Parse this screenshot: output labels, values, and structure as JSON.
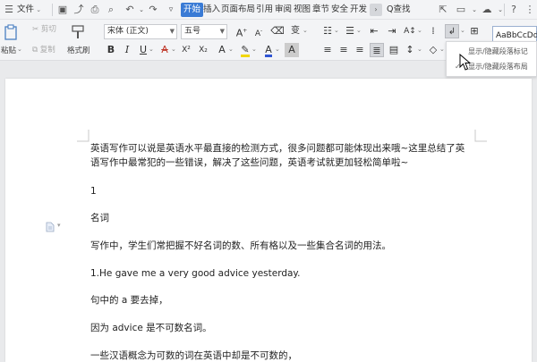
{
  "menubar": {
    "file_label": "文件",
    "tabs": [
      {
        "label": "开始",
        "active": true
      },
      {
        "label": "插入",
        "active": false
      },
      {
        "label": "页面布局",
        "active": false
      },
      {
        "label": "引用",
        "active": false
      },
      {
        "label": "审阅",
        "active": false
      },
      {
        "label": "视图",
        "active": false
      },
      {
        "label": "章节",
        "active": false
      },
      {
        "label": "安全",
        "active": false
      },
      {
        "label": "开发",
        "active": false
      }
    ],
    "search_label": "Q查找"
  },
  "ribbon": {
    "paste_label": "粘贴",
    "cut_label": "剪切",
    "copy_label": "复制",
    "format_painter_label": "格式刷",
    "font_family": "宋体 (正文)",
    "font_size": "五号",
    "style_preview": "AaBbCcDd"
  },
  "popup": {
    "items": [
      {
        "label": "显示/隐藏段落标记",
        "checked": false
      },
      {
        "label": "显示/隐藏段落布局",
        "checked": true
      }
    ]
  },
  "document": {
    "paragraphs": [
      "英语写作可以说是英语水平最直接的检测方式，很多问题都可能体现出来哦~这里总结了英",
      "语写作中最常犯的一些错误，解决了这些问题，英语考试就更加轻松简单啦~",
      "1",
      "名词",
      "写作中，学生们常把握不好名词的数、所有格以及一些集合名词的用法。",
      "1.He gave me a very good advice yesterday.",
      "句中的 a 要去掉，",
      "因为 advice 是不可数名词。",
      "一些汉语概念为可数的词在英语中却是不可数的，"
    ]
  },
  "colors": {
    "accent": "#3a7bd5",
    "highlight_yellow": "#f2d700",
    "font_color_red": "#e03c31",
    "font_color_blue": "#2f55d4"
  }
}
